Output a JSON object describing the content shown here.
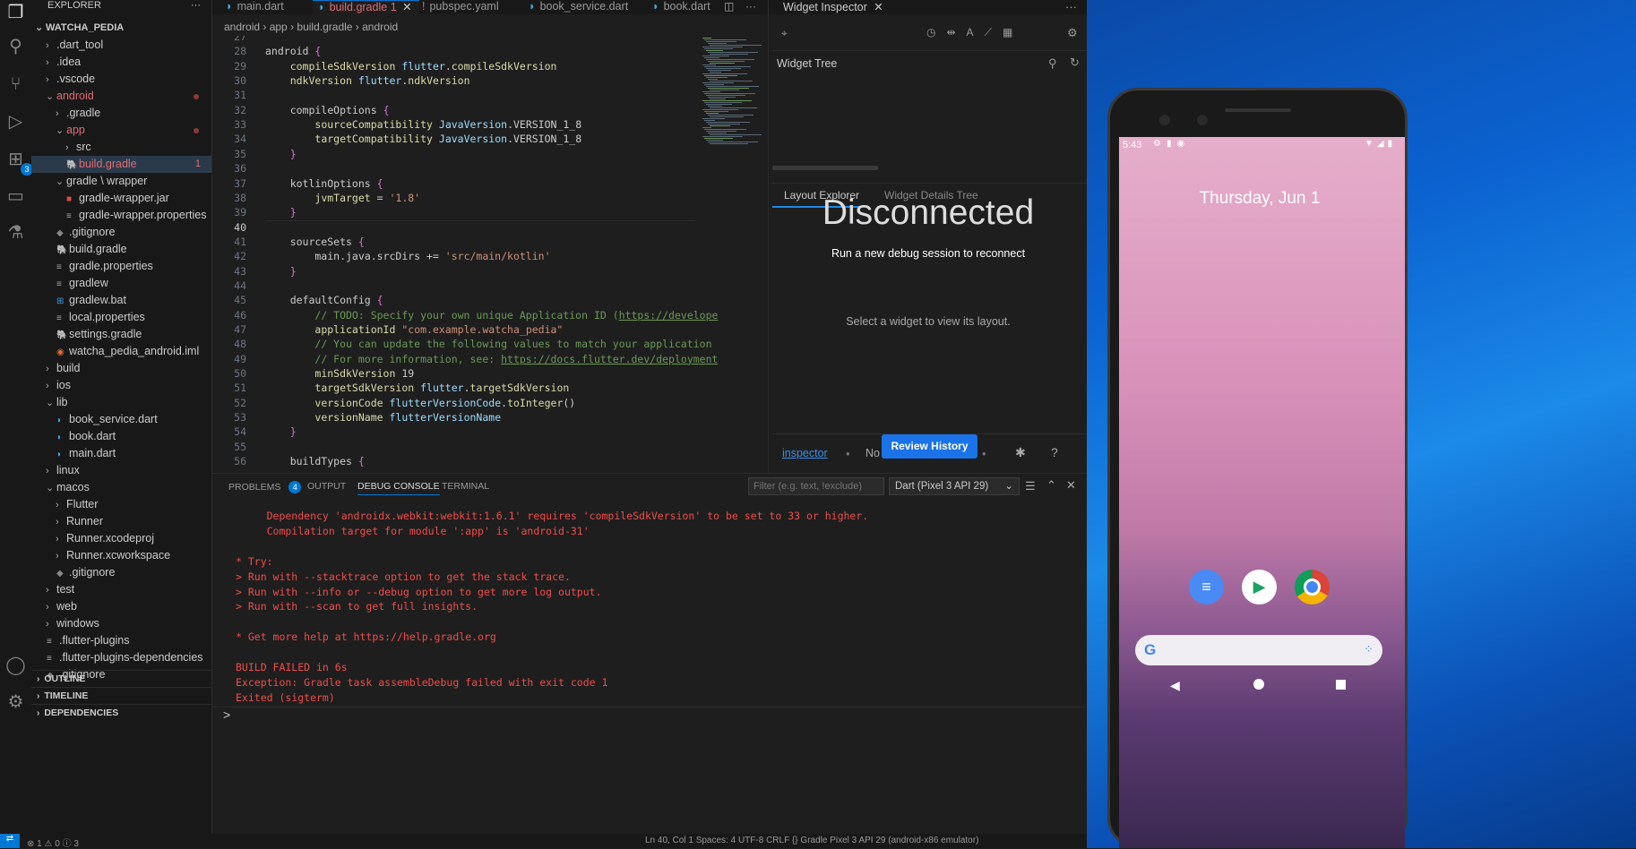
{
  "explorer": {
    "title": "EXPLORER",
    "project": "WATCHA_PEDIA",
    "items": [
      {
        "label": ".dart_tool",
        "depth": 1,
        "type": "folder",
        "state": "closed"
      },
      {
        "label": ".idea",
        "depth": 1,
        "type": "folder",
        "state": "closed"
      },
      {
        "label": ".vscode",
        "depth": 1,
        "type": "folder",
        "state": "closed"
      },
      {
        "label": "android",
        "depth": 1,
        "type": "folder",
        "state": "open",
        "error": true,
        "dot": true
      },
      {
        "label": ".gradle",
        "depth": 2,
        "type": "folder",
        "state": "closed"
      },
      {
        "label": "app",
        "depth": 2,
        "type": "folder",
        "state": "open",
        "error": true,
        "dot": true
      },
      {
        "label": "src",
        "depth": 3,
        "type": "folder",
        "state": "closed"
      },
      {
        "label": "build.gradle",
        "depth": 3,
        "type": "gradle",
        "selected": true,
        "error": true,
        "count": "1"
      },
      {
        "label": "gradle \\ wrapper",
        "depth": 2,
        "type": "folder",
        "state": "open"
      },
      {
        "label": "gradle-wrapper.jar",
        "depth": 3,
        "type": "jar"
      },
      {
        "label": "gradle-wrapper.properties",
        "depth": 3,
        "type": "props"
      },
      {
        "label": ".gitignore",
        "depth": 2,
        "type": "git"
      },
      {
        "label": "build.gradle",
        "depth": 2,
        "type": "gradle"
      },
      {
        "label": "gradle.properties",
        "depth": 2,
        "type": "props"
      },
      {
        "label": "gradlew",
        "depth": 2,
        "type": "props"
      },
      {
        "label": "gradlew.bat",
        "depth": 2,
        "type": "win"
      },
      {
        "label": "local.properties",
        "depth": 2,
        "type": "props"
      },
      {
        "label": "settings.gradle",
        "depth": 2,
        "type": "gradle"
      },
      {
        "label": "watcha_pedia_android.iml",
        "depth": 2,
        "type": "rss"
      },
      {
        "label": "build",
        "depth": 1,
        "type": "folder",
        "state": "closed"
      },
      {
        "label": "ios",
        "depth": 1,
        "type": "folder",
        "state": "closed"
      },
      {
        "label": "lib",
        "depth": 1,
        "type": "folder",
        "state": "open"
      },
      {
        "label": "book_service.dart",
        "depth": 2,
        "type": "dart"
      },
      {
        "label": "book.dart",
        "depth": 2,
        "type": "dart"
      },
      {
        "label": "main.dart",
        "depth": 2,
        "type": "dart"
      },
      {
        "label": "linux",
        "depth": 1,
        "type": "folder",
        "state": "closed"
      },
      {
        "label": "macos",
        "depth": 1,
        "type": "folder",
        "state": "open"
      },
      {
        "label": "Flutter",
        "depth": 2,
        "type": "folder",
        "state": "closed"
      },
      {
        "label": "Runner",
        "depth": 2,
        "type": "folder",
        "state": "closed"
      },
      {
        "label": "Runner.xcodeproj",
        "depth": 2,
        "type": "folder",
        "state": "closed"
      },
      {
        "label": "Runner.xcworkspace",
        "depth": 2,
        "type": "folder",
        "state": "closed"
      },
      {
        "label": ".gitignore",
        "depth": 2,
        "type": "git"
      },
      {
        "label": "test",
        "depth": 1,
        "type": "folder",
        "state": "closed"
      },
      {
        "label": "web",
        "depth": 1,
        "type": "folder",
        "state": "closed"
      },
      {
        "label": "windows",
        "depth": 1,
        "type": "folder",
        "state": "closed"
      },
      {
        "label": ".flutter-plugins",
        "depth": 1,
        "type": "props"
      },
      {
        "label": ".flutter-plugins-dependencies",
        "depth": 1,
        "type": "props"
      },
      {
        "label": ".gitignore",
        "depth": 1,
        "type": "git"
      }
    ],
    "sections": [
      "OUTLINE",
      "TIMELINE",
      "DEPENDENCIES"
    ]
  },
  "activity": {
    "extensions_badge": "3"
  },
  "tabs": [
    {
      "label": "main.dart",
      "icon": "dart"
    },
    {
      "label": "build.gradle",
      "badge": "1",
      "active": true,
      "icon": "gradle"
    },
    {
      "label": "pubspec.yaml",
      "icon": "yaml"
    },
    {
      "label": "book_service.dart",
      "icon": "dart"
    },
    {
      "label": "book.dart",
      "icon": "dart"
    }
  ],
  "breadcrumb": [
    "android",
    "app",
    "build.gradle",
    "android"
  ],
  "code": [
    {
      "n": "27",
      "t": ""
    },
    {
      "n": "28",
      "t": "android {"
    },
    {
      "n": "29",
      "t": "    compileSdkVersion flutter.compileSdkVersion"
    },
    {
      "n": "30",
      "t": "    ndkVersion flutter.ndkVersion"
    },
    {
      "n": "31",
      "t": ""
    },
    {
      "n": "32",
      "t": "    compileOptions {"
    },
    {
      "n": "33",
      "t": "        sourceCompatibility JavaVersion.VERSION_1_8"
    },
    {
      "n": "34",
      "t": "        targetCompatibility JavaVersion.VERSION_1_8"
    },
    {
      "n": "35",
      "t": "    }"
    },
    {
      "n": "36",
      "t": ""
    },
    {
      "n": "37",
      "t": "    kotlinOptions {"
    },
    {
      "n": "38",
      "t": "        jvmTarget = '1.8'"
    },
    {
      "n": "39",
      "t": "    }"
    },
    {
      "n": "40",
      "t": ""
    },
    {
      "n": "41",
      "t": "    sourceSets {"
    },
    {
      "n": "42",
      "t": "        main.java.srcDirs += 'src/main/kotlin'"
    },
    {
      "n": "43",
      "t": "    }"
    },
    {
      "n": "44",
      "t": ""
    },
    {
      "n": "45",
      "t": "    defaultConfig {"
    },
    {
      "n": "46",
      "t": "        // TODO: Specify your own unique Application ID (https://develope"
    },
    {
      "n": "47",
      "t": "        applicationId \"com.example.watcha_pedia\""
    },
    {
      "n": "48",
      "t": "        // You can update the following values to match your application"
    },
    {
      "n": "49",
      "t": "        // For more information, see: https://docs.flutter.dev/deployment"
    },
    {
      "n": "50",
      "t": "        minSdkVersion 19"
    },
    {
      "n": "51",
      "t": "        targetSdkVersion flutter.targetSdkVersion"
    },
    {
      "n": "52",
      "t": "        versionCode flutterVersionCode.toInteger()"
    },
    {
      "n": "53",
      "t": "        versionName flutterVersionName"
    },
    {
      "n": "54",
      "t": "    }"
    },
    {
      "n": "55",
      "t": ""
    },
    {
      "n": "56",
      "t": "    buildTypes {"
    }
  ],
  "inspector": {
    "title": "Widget Inspector",
    "widget_tree": "Widget Tree",
    "tab_layout": "Layout Explorer",
    "tab_details": "Widget Details Tree",
    "disconnected": "Disconnected",
    "reconnect": "Run a new debug session to reconnect",
    "select_hint": "Select a widget to view its layout.",
    "inspector_link": "inspector",
    "no_text": "No",
    "review_button": "Review History"
  },
  "panel": {
    "tabs": [
      "PROBLEMS",
      "OUTPUT",
      "DEBUG CONSOLE",
      "TERMINAL"
    ],
    "problems_count": "4",
    "filter_placeholder": "Filter (e.g. text, !exclude)",
    "session": "Dart (Pixel 3 API 29)",
    "console": [
      {
        "t": "     Dependency 'androidx.webkit:webkit:1.6.1' requires 'compileSdkVersion' to be set to 33 or higher."
      },
      {
        "t": "     Compilation target for module ':app' is 'android-31'"
      },
      {
        "t": ""
      },
      {
        "t": "* Try:"
      },
      {
        "t": "> Run with --stacktrace option to get the stack trace."
      },
      {
        "t": "> Run with --info or --debug option to get more log output."
      },
      {
        "t": "> Run with --scan to get full insights."
      },
      {
        "t": ""
      },
      {
        "t": "* Get more help at https://help.gradle.org"
      },
      {
        "t": ""
      },
      {
        "t": "BUILD FAILED in 6s"
      },
      {
        "t": "Exception: Gradle task assembleDebug failed with exit code 1"
      },
      {
        "t": "Exited (sigterm)"
      }
    ],
    "prompt": ">"
  },
  "status": {
    "left": "⊗ 1 ⚠ 0 ⓘ 3",
    "right": "Ln 40, Col 1   Spaces: 4   UTF-8   CRLF   {} Gradle   Pixel 3 API 29 (android-x86 emulator)"
  },
  "phone": {
    "time": "5:43",
    "date": "Thursday, Jun 1"
  },
  "colors": {
    "accent": "#0078d4",
    "error": "#f14c4c",
    "button": "#1a73e8"
  }
}
